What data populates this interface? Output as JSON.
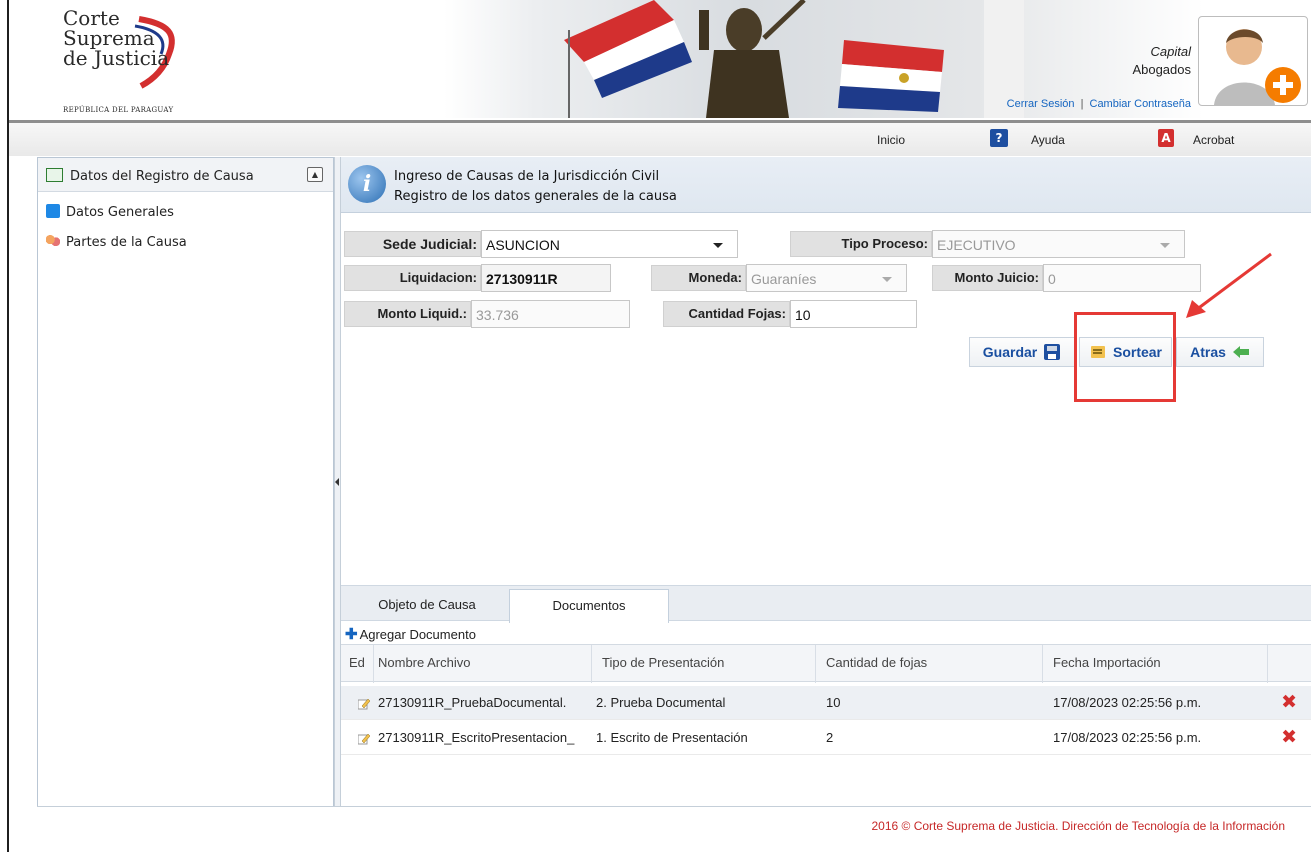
{
  "header": {
    "logo": {
      "line1": "Corte",
      "line2": "Suprema",
      "line3": "de Justicia",
      "sub": "REPÚBLICA DEL PARAGUAY"
    },
    "user_city": "Capital",
    "user_role": "Abogados",
    "logout_label": "Cerrar Sesión",
    "separator": "|",
    "change_password_label": "Cambiar Contraseña"
  },
  "nav": {
    "home": "Inicio",
    "help": "Ayuda",
    "acrobat": "Acrobat"
  },
  "sidebar": {
    "title": "Datos del Registro de Causa",
    "items": [
      {
        "label": "Datos Generales"
      },
      {
        "label": "Partes de la Causa"
      }
    ]
  },
  "info": {
    "line1": "Ingreso de Causas de la Jurisdicción Civil",
    "line2": "Registro de los datos generales de la causa"
  },
  "form": {
    "sede_label": "Sede Judicial:",
    "sede_value": "ASUNCION",
    "tipo_label": "Tipo Proceso:",
    "tipo_value": "EJECUTIVO",
    "liq_label": "Liquidacion:",
    "liq_value": "27130911R",
    "moneda_label": "Moneda:",
    "moneda_value": "Guaraníes",
    "monto_juicio_label": "Monto Juicio:",
    "monto_juicio_value": "0",
    "monto_liq_label": "Monto Liquid.:",
    "monto_liq_value": "33.736",
    "fojas_label": "Cantidad Fojas:",
    "fojas_value": "10"
  },
  "actions": {
    "save": "Guardar",
    "draw": "Sortear",
    "back": "Atras"
  },
  "tabs": [
    {
      "label": "Objeto de Causa"
    },
    {
      "label": "Documentos"
    }
  ],
  "add_document": "Agregar Documento",
  "grid": {
    "columns": [
      "Ed",
      "Nombre Archivo",
      "Tipo de Presentación",
      "Cantidad de fojas",
      "Fecha Importación"
    ],
    "rows": [
      {
        "name": "27130911R_PruebaDocumental.",
        "type": "2. Prueba Documental",
        "fojas": "10",
        "date": "17/08/2023 02:25:56 p.m."
      },
      {
        "name": "27130911R_EscritoPresentacion_",
        "type": "1. Escrito de Presentación",
        "fojas": "2",
        "date": "17/08/2023 02:25:56 p.m."
      }
    ]
  },
  "footer": "2016 © Corte Suprema de Justicia. Dirección de Tecnología de la Información",
  "colors": {
    "accent": "#1565c0",
    "highlight": "#e53935",
    "footer": "#c62828"
  }
}
